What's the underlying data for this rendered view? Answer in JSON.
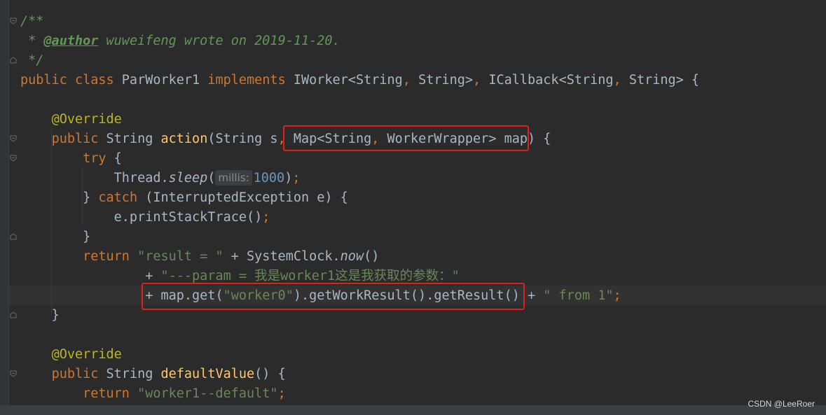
{
  "editor": {
    "lines": [
      {
        "id": "l1",
        "tokens": [
          {
            "t": "/**",
            "c": "cm"
          }
        ]
      },
      {
        "id": "l2",
        "tokens": [
          {
            "t": " * ",
            "c": "cm"
          },
          {
            "t": "@author",
            "c": "tag"
          },
          {
            "t": " wuweifeng wrote on 2019-11-20.",
            "c": "cm"
          }
        ]
      },
      {
        "id": "l3",
        "tokens": [
          {
            "t": " */",
            "c": "cm"
          }
        ]
      },
      {
        "id": "l4",
        "tokens": [
          {
            "t": "public class ",
            "c": "kw"
          },
          {
            "t": "ParWorker1 "
          },
          {
            "t": "implements ",
            "c": "kw"
          },
          {
            "t": "IWorker<String"
          },
          {
            "t": ", ",
            "c": "kw"
          },
          {
            "t": "String>"
          },
          {
            "t": ", ",
            "c": "kw"
          },
          {
            "t": "ICallback<String"
          },
          {
            "t": ", ",
            "c": "kw"
          },
          {
            "t": "String> {"
          }
        ]
      },
      {
        "id": "l5",
        "tokens": []
      },
      {
        "id": "l6",
        "tokens": [
          {
            "t": "    "
          },
          {
            "t": "@Override",
            "c": "ann"
          }
        ]
      },
      {
        "id": "l7",
        "tokens": [
          {
            "t": "    "
          },
          {
            "t": "public ",
            "c": "kw"
          },
          {
            "t": "String "
          },
          {
            "t": "action",
            "c": "fn"
          },
          {
            "t": "(String s"
          },
          {
            "t": ", ",
            "c": "kw"
          },
          {
            "t": "Map<String"
          },
          {
            "t": ", ",
            "c": "kw"
          },
          {
            "t": "WorkerWrapper> map) {"
          }
        ]
      },
      {
        "id": "l8",
        "tokens": [
          {
            "t": "        "
          },
          {
            "t": "try ",
            "c": "kw"
          },
          {
            "t": "{"
          }
        ]
      },
      {
        "id": "l9",
        "tokens": [
          {
            "t": "            Thread."
          },
          {
            "t": "sleep",
            "c": "it"
          },
          {
            "t": "("
          },
          {
            "t": "millis:",
            "c": "hint"
          },
          {
            "t": "1000",
            "c": "num"
          },
          {
            "t": ")"
          },
          {
            "t": ";",
            "c": "kw"
          }
        ]
      },
      {
        "id": "l10",
        "tokens": [
          {
            "t": "        } "
          },
          {
            "t": "catch ",
            "c": "kw"
          },
          {
            "t": "(InterruptedException e) {"
          }
        ]
      },
      {
        "id": "l11",
        "tokens": [
          {
            "t": "            e.printStackTrace()"
          },
          {
            "t": ";",
            "c": "kw"
          }
        ]
      },
      {
        "id": "l12",
        "tokens": [
          {
            "t": "        }"
          }
        ]
      },
      {
        "id": "l13",
        "tokens": [
          {
            "t": "        "
          },
          {
            "t": "return ",
            "c": "kw"
          },
          {
            "t": "\"result = \" ",
            "c": "str"
          },
          {
            "t": "+ SystemClock."
          },
          {
            "t": "now",
            "c": "it"
          },
          {
            "t": "()"
          }
        ]
      },
      {
        "id": "l14",
        "tokens": [
          {
            "t": "                + "
          },
          {
            "t": "\"---param = ",
            "c": "str"
          },
          {
            "t": "我是",
            "c": "str cjk"
          },
          {
            "t": "worker1",
            "c": "str"
          },
          {
            "t": "这是我获取的参数：",
            "c": "str cjk"
          },
          {
            "t": "\"",
            "c": "str"
          }
        ]
      },
      {
        "id": "l15",
        "tokens": [
          {
            "t": "                + map.get("
          },
          {
            "t": "\"worker0\"",
            "c": "str"
          },
          {
            "t": ").getWorkResult().getResult() + "
          },
          {
            "t": "\" from 1\"",
            "c": "str"
          },
          {
            "t": ";",
            "c": "kw"
          }
        ]
      },
      {
        "id": "l16",
        "tokens": [
          {
            "t": "    }"
          }
        ]
      },
      {
        "id": "l17",
        "tokens": []
      },
      {
        "id": "l18",
        "tokens": [
          {
            "t": "    "
          },
          {
            "t": "@Override",
            "c": "ann"
          }
        ]
      },
      {
        "id": "l19",
        "tokens": [
          {
            "t": "    "
          },
          {
            "t": "public ",
            "c": "kw"
          },
          {
            "t": "String "
          },
          {
            "t": "defaultValue",
            "c": "fn"
          },
          {
            "t": "() {"
          }
        ]
      },
      {
        "id": "l20",
        "tokens": [
          {
            "t": "        "
          },
          {
            "t": "return ",
            "c": "kw"
          },
          {
            "t": "\"worker1--default\"",
            "c": "str"
          },
          {
            "t": ";",
            "c": "kw"
          }
        ]
      }
    ]
  },
  "watermark": "CSDN @LeeRoer",
  "colors": {
    "background": "#2b2b2b",
    "keyword": "#cc7832",
    "string": "#6a8759",
    "number": "#6897bb",
    "annotation": "#bbb529",
    "method": "#ffc66d",
    "doc_comment": "#629755",
    "highlight_box": "#e0201b"
  }
}
